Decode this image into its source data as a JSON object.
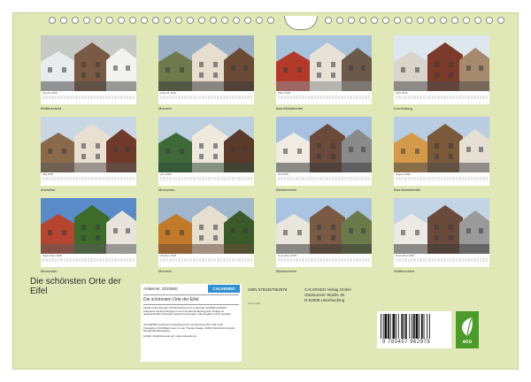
{
  "months": [
    {
      "label": "Januar 2025",
      "caption": "Reifferscheid"
    },
    {
      "label": "Februar 2025",
      "caption": "Monreal"
    },
    {
      "label": "März 2025",
      "caption": "Bad Münstereifel"
    },
    {
      "label": "April 2025",
      "caption": "Kronenburg"
    },
    {
      "label": "Mai 2025",
      "caption": "Ahrweiler"
    },
    {
      "label": "Juni 2025",
      "caption": "Monschau"
    },
    {
      "label": "Juli 2025",
      "caption": "Blankenheim"
    },
    {
      "label": "August 2025",
      "caption": "Bad Münstereifel"
    },
    {
      "label": "September 2025",
      "caption": "Monschau"
    },
    {
      "label": "Oktober 2025",
      "caption": "Monreal"
    },
    {
      "label": "November 2025",
      "caption": "Blankenheim"
    },
    {
      "label": "Dezember 2025",
      "caption": "Reifferscheid"
    }
  ],
  "title": "Die schönsten Orte der Eifel",
  "info": {
    "article": "Artikel-Nr. 2010900",
    "calvendo_logo": "CALVENDO",
    "subtitle": "Die schönsten Orte der Eifel",
    "description": "Intriga bezeichnender Schanzwerke ist es unbeirrigt, als Bildes Hibelbl-Kalenders herauszubringen und ohne Einschränkung das Verlags zu gewissenhaften Zwecken weiterzuverwenden. Alle Angaben ohne Gewähr.",
    "description2": "CALVENDO produziert bedarfsgerecht und klimaneutral in DE & EU. Fotografen CO2-Bilanz kann zu der Transportwege. Abfall: Reduzierung dank Einzelbedarfsfertigung.",
    "email": "E-Mail: info@calvendo.de | www.calvendo.de",
    "isbn": "ISBN 9783457962978",
    "author": "Anna Hübl",
    "publisher": "CALVENDO Verlag GmbH",
    "street": "Ottobrunner Straße 39",
    "city": "D-82008 Unterhaching",
    "barcode_number": "9 783457 962978",
    "eco_label": "eco"
  },
  "colors": {
    "page_bg": "#dfe8b6",
    "eco_green": "#4c9a2a"
  }
}
